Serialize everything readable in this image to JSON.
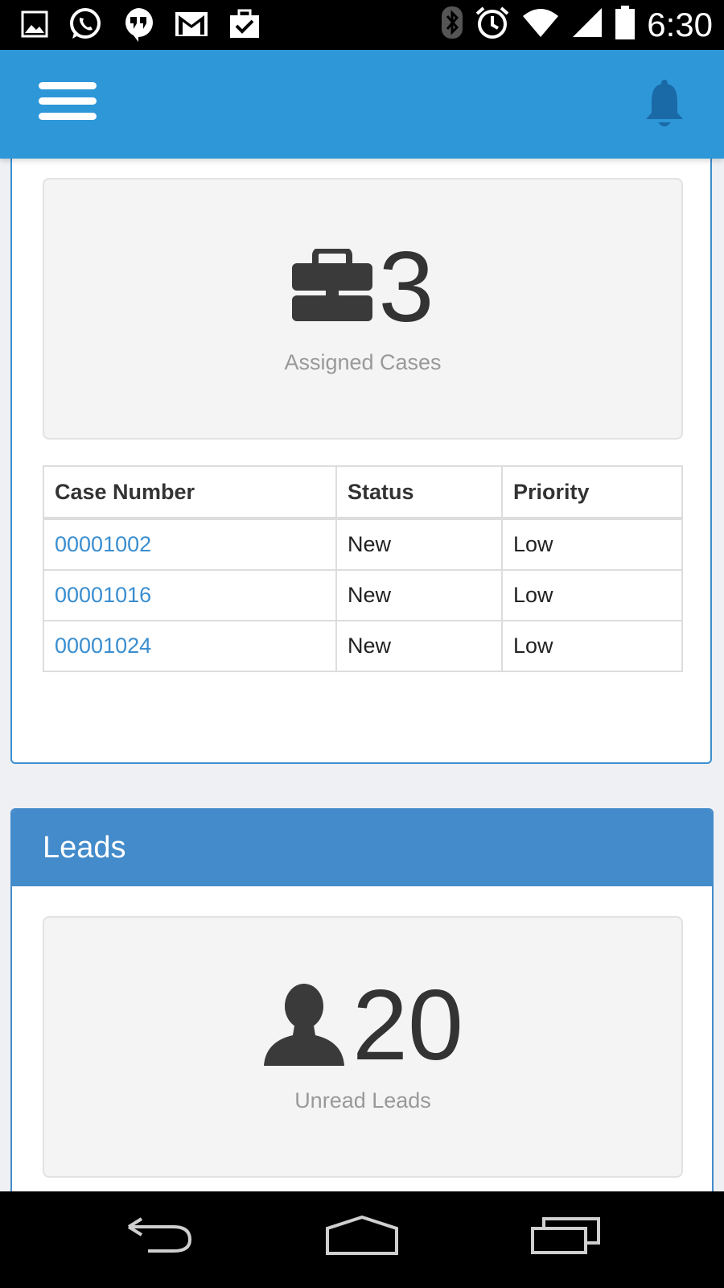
{
  "status_bar": {
    "time": "6:30",
    "left_icons": [
      "image-icon",
      "whatsapp-icon",
      "hangouts-icon",
      "gmail-icon",
      "tasks-icon"
    ],
    "right_icons": [
      "bluetooth-icon",
      "alarm-icon",
      "wifi-icon",
      "cell-signal-icon",
      "battery-icon"
    ]
  },
  "app_bar": {
    "color": "#2e97d8",
    "menu_icon": "hamburger-menu-icon",
    "notification_icon": "bell-icon"
  },
  "cases": {
    "count": "3",
    "label": "Assigned Cases",
    "icon": "briefcase-icon",
    "table": {
      "headers": [
        "Case Number",
        "Status",
        "Priority"
      ],
      "rows": [
        {
          "case_number": "00001002",
          "status": "New",
          "priority": "Low"
        },
        {
          "case_number": "00001016",
          "status": "New",
          "priority": "Low"
        },
        {
          "case_number": "00001024",
          "status": "New",
          "priority": "Low"
        }
      ]
    }
  },
  "leads": {
    "title": "Leads",
    "count": "20",
    "label": "Unread Leads",
    "icon": "user-icon",
    "header_color": "#438bca"
  },
  "nav_bar": {
    "buttons": [
      "back-icon",
      "home-icon",
      "recent-apps-icon"
    ]
  }
}
